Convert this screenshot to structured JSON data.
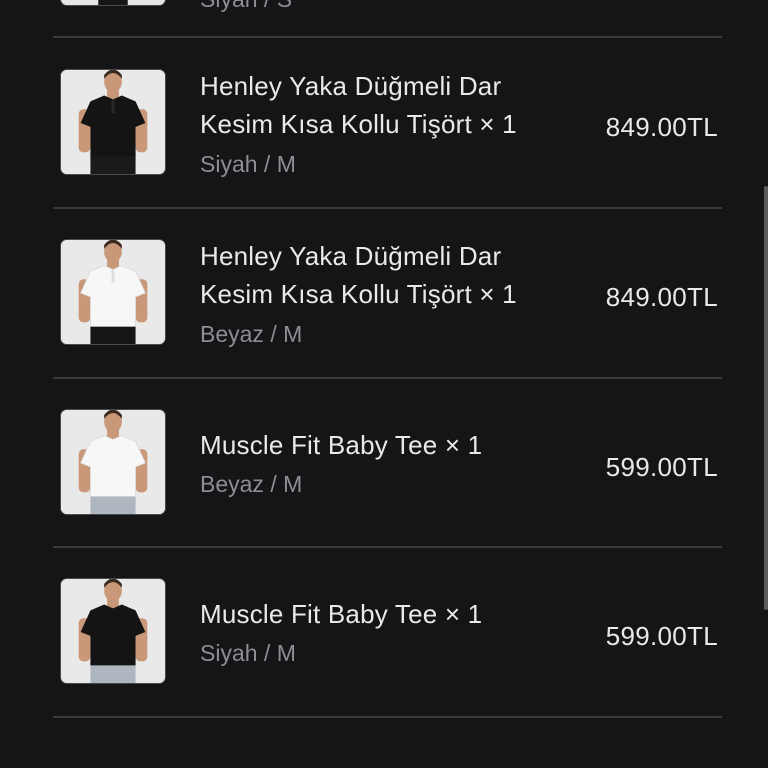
{
  "top_partial": {
    "variant": "Siyah / S"
  },
  "items": [
    {
      "title": "Henley Yaka Düğmeli Dar Kesim Kısa Kollu Tişört × 1",
      "variant": "Siyah / M",
      "price": "849.00TL",
      "shirt_color": "#141414",
      "pants_color": "#1a1a1a",
      "shirt_style": "henley"
    },
    {
      "title": "Henley Yaka Düğmeli Dar Kesim Kısa Kollu Tişört × 1",
      "variant": "Beyaz / M",
      "price": "849.00TL",
      "shirt_color": "#f7f7f7",
      "pants_color": "#151515",
      "shirt_style": "henley"
    },
    {
      "title": "Muscle Fit Baby Tee × 1",
      "variant": "Beyaz / M",
      "price": "599.00TL",
      "shirt_color": "#f7f7f7",
      "pants_color": "#aeb6c0",
      "shirt_style": "crew"
    },
    {
      "title": "Muscle Fit Baby Tee × 1",
      "variant": "Siyah / M",
      "price": "599.00TL",
      "shirt_color": "#141414",
      "pants_color": "#aeb6c0",
      "shirt_style": "crew"
    }
  ],
  "colors": {
    "background": "#151517",
    "divider": "#3a3a3c",
    "text_primary": "#e9e9ea",
    "text_secondary": "#8e8e92"
  }
}
